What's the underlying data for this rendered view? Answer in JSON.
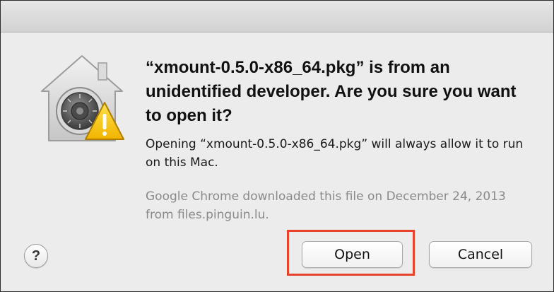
{
  "dialog": {
    "title": "“xmount-0.5.0-x86_64.pkg” is from an unidentified developer. Are you sure you want to open it?",
    "message": "Opening “xmount-0.5.0-x86_64.pkg” will always allow it to run on this Mac.",
    "source_note": "Google Chrome downloaded this file on December 24, 2013 from files.pinguin.lu.",
    "icon": "gatekeeper-security-warning-icon"
  },
  "buttons": {
    "help_label": "?",
    "open_label": "Open",
    "cancel_label": "Cancel"
  },
  "annotation": {
    "highlight_target": "Open",
    "highlight_color": "#e8412c"
  }
}
